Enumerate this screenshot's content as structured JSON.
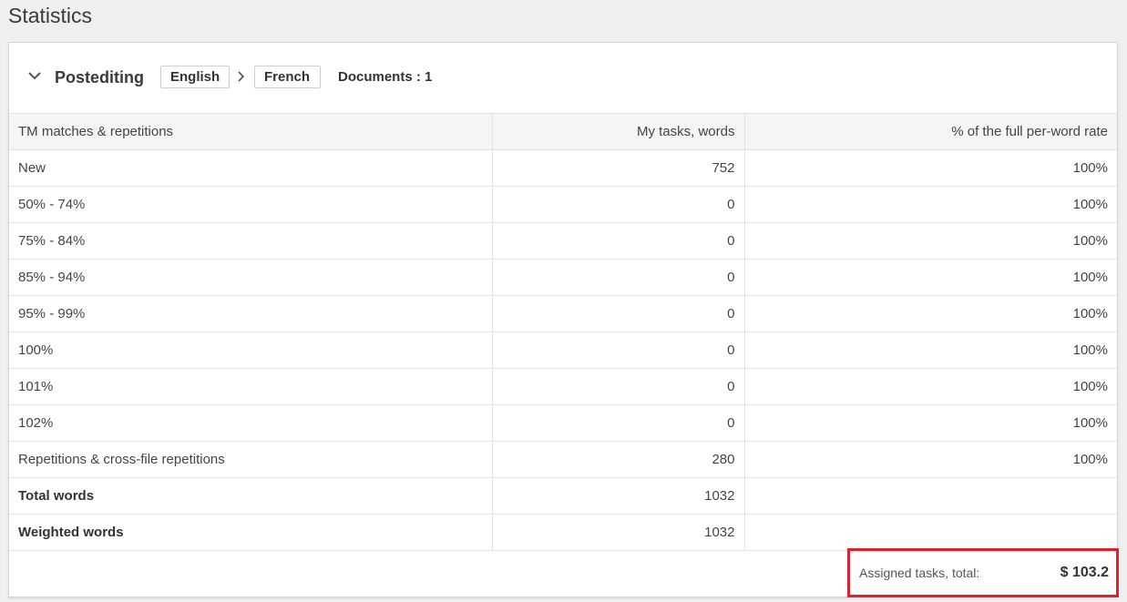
{
  "page": {
    "title": "Statistics"
  },
  "section": {
    "title": "Postediting",
    "source_language": "English",
    "target_language": "French",
    "documents_label": "Documents : 1"
  },
  "table": {
    "headers": [
      "TM matches & repetitions",
      "My tasks, words",
      "% of the full per-word rate"
    ],
    "rows": [
      {
        "label": "New",
        "words": "752",
        "rate": "100%"
      },
      {
        "label": "50% - 74%",
        "words": "0",
        "rate": "100%"
      },
      {
        "label": "75% - 84%",
        "words": "0",
        "rate": "100%"
      },
      {
        "label": "85% - 94%",
        "words": "0",
        "rate": "100%"
      },
      {
        "label": "95% - 99%",
        "words": "0",
        "rate": "100%"
      },
      {
        "label": "100%",
        "words": "0",
        "rate": "100%"
      },
      {
        "label": "101%",
        "words": "0",
        "rate": "100%"
      },
      {
        "label": "102%",
        "words": "0",
        "rate": "100%"
      },
      {
        "label": "Repetitions & cross-file repetitions",
        "words": "280",
        "rate": "100%"
      },
      {
        "label": "Total words",
        "words": "1032",
        "rate": ""
      },
      {
        "label": "Weighted words",
        "words": "1032",
        "rate": ""
      }
    ]
  },
  "footer": {
    "total_label": "Assigned tasks, total:",
    "total_value": "$ 103.2"
  },
  "icons": {
    "collapse": "chevron-down-icon",
    "language_arrow": "chevron-right-icon"
  },
  "colors": {
    "highlight_border": "#e0202a",
    "header_background": "#f5f5f5"
  }
}
